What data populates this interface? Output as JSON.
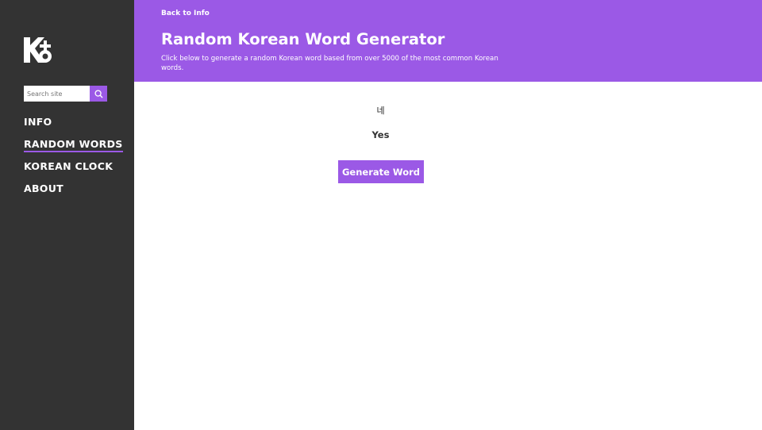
{
  "sidebar": {
    "logo_icon": "korean-logo-icon",
    "search": {
      "placeholder": "Search site",
      "icon": "search-icon"
    },
    "nav": [
      {
        "label": "INFO",
        "active": false
      },
      {
        "label": "RANDOM WORDS",
        "active": true
      },
      {
        "label": "KOREAN CLOCK",
        "active": false
      },
      {
        "label": "ABOUT",
        "active": false
      }
    ]
  },
  "header": {
    "back_link": "Back to Info",
    "title": "Random Korean Word Generator",
    "subtitle": "Click below to generate a random Korean word based from over 5000 of the most common Korean words."
  },
  "main": {
    "korean_word": "네",
    "english_word": "Yes",
    "generate_label": "Generate Word"
  },
  "colors": {
    "accent": "#9b59e6",
    "sidebar_bg": "#333333"
  }
}
